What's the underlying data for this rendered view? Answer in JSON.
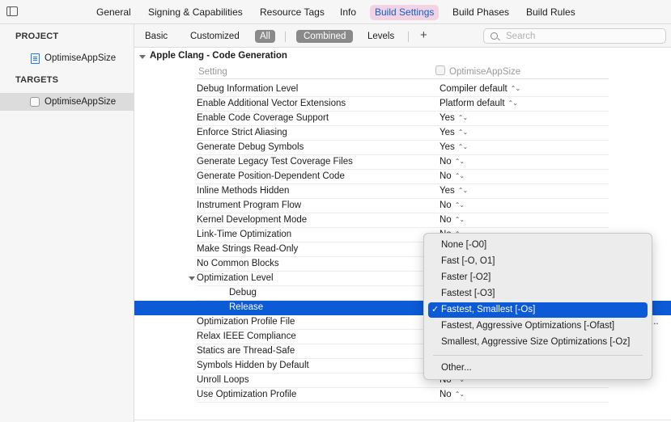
{
  "top_tabs": [
    "General",
    "Signing & Capabilities",
    "Resource Tags",
    "Info",
    "Build Settings",
    "Build Phases",
    "Build Rules"
  ],
  "sidebar": {
    "project_header": "PROJECT",
    "project_item": "OptimiseAppSize",
    "targets_header": "TARGETS",
    "target_item": "OptimiseAppSize"
  },
  "filter": {
    "basic": "Basic",
    "customized": "Customized",
    "all": "All",
    "combined": "Combined",
    "levels": "Levels",
    "add": "+",
    "search_placeholder": "Search"
  },
  "section": {
    "title": "Apple Clang - Code Generation",
    "setting_col": "Setting",
    "target_col": "OptimiseAppSize"
  },
  "rows": [
    {
      "name": "Debug Information Level",
      "value": "Compiler default"
    },
    {
      "name": "Enable Additional Vector Extensions",
      "value": "Platform default"
    },
    {
      "name": "Enable Code Coverage Support",
      "value": "Yes"
    },
    {
      "name": "Enforce Strict Aliasing",
      "value": "Yes"
    },
    {
      "name": "Generate Debug Symbols",
      "value": "Yes"
    },
    {
      "name": "Generate Legacy Test Coverage Files",
      "value": "No"
    },
    {
      "name": "Generate Position-Dependent Code",
      "value": "No"
    },
    {
      "name": "Inline Methods Hidden",
      "value": "Yes"
    },
    {
      "name": "Instrument Program Flow",
      "value": "No"
    },
    {
      "name": "Kernel Development Mode",
      "value": "No"
    },
    {
      "name": "Link-Time Optimization",
      "value": "No"
    },
    {
      "name": "Make Strings Read-Only",
      "value": ""
    },
    {
      "name": "No Common Blocks",
      "value": ""
    },
    {
      "name": "Optimization Level",
      "value": ""
    },
    {
      "name": "Debug",
      "value": ""
    },
    {
      "name": "Release",
      "value": ""
    },
    {
      "name": "Optimization Profile File",
      "value": ""
    },
    {
      "name": "Relax IEEE Compliance",
      "value": ""
    },
    {
      "name": "Statics are Thread-Safe",
      "value": ""
    },
    {
      "name": "Symbols Hidden by Default",
      "value": ""
    },
    {
      "name": "Unroll Loops",
      "value": "No"
    },
    {
      "name": "Use Optimization Profile",
      "value": "No"
    }
  ],
  "menu": {
    "items": [
      "None [-O0]",
      "Fast [-O, O1]",
      "Faster [-O2]",
      "Fastest [-O3]",
      "Fastest, Smallest [-Os]",
      "Fastest, Aggressive Optimizations [-Ofast]",
      "Smallest, Aggressive Size Optimizations [-Oz]"
    ],
    "selected": "Fastest, Smallest [-Os]",
    "other": "Other...",
    "check": "✓"
  },
  "icons": {
    "stepper": "⌃⌄",
    "ellipsis": "..."
  }
}
